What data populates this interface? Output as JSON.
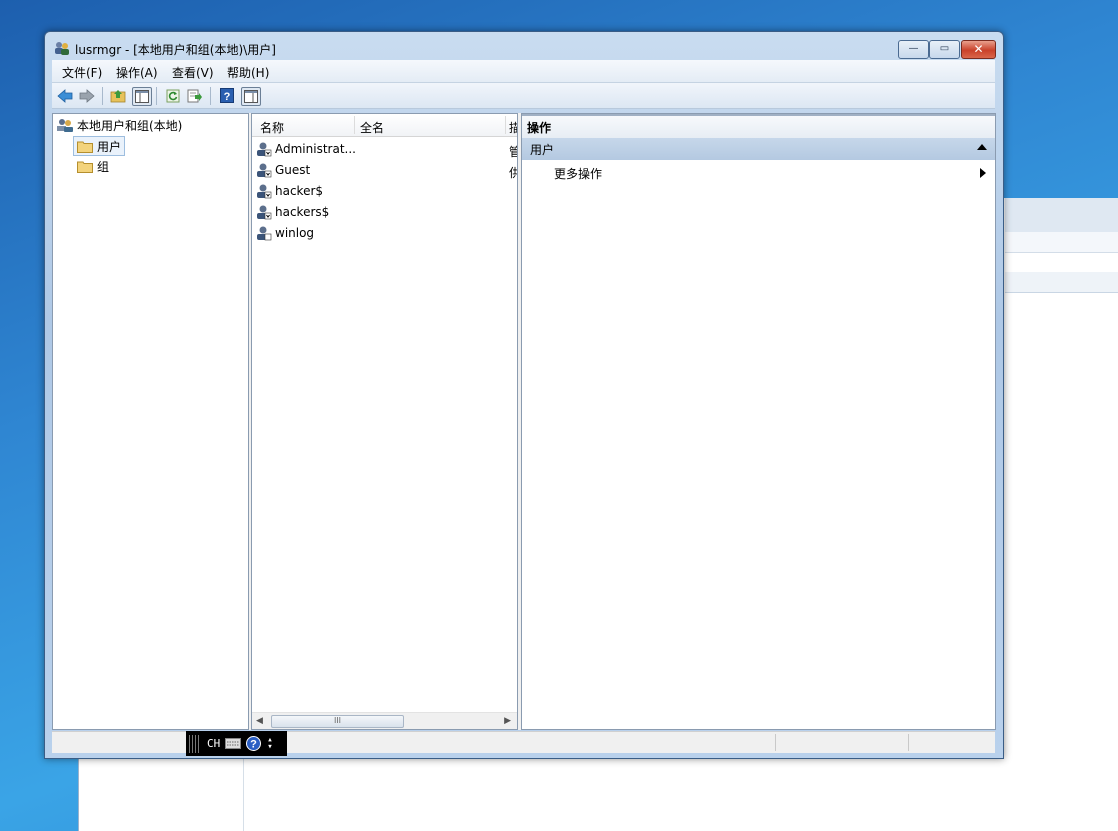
{
  "window": {
    "title": "lusrmgr - [本地用户和组(本地)\\用户]",
    "minimize_glyph": "—",
    "maximize_glyph": "▭",
    "close_glyph": "✕"
  },
  "menu": {
    "items": [
      "文件(F)",
      "操作(A)",
      "查看(V)",
      "帮助(H)"
    ]
  },
  "toolbar": {
    "icons": [
      "back-arrow-icon",
      "forward-arrow-icon",
      "up-folder-icon",
      "show-hide-tree-icon",
      "refresh-icon",
      "export-list-icon",
      "help-icon",
      "show-hide-action-pane-icon"
    ]
  },
  "tree": {
    "root": "本地用户和组(本地)",
    "items": [
      "用户",
      "组"
    ],
    "selected": "用户"
  },
  "list": {
    "columns": [
      "名称",
      "全名",
      "描"
    ],
    "rows": [
      {
        "name": "Administrat...",
        "fullname": "",
        "desc_clip": "管"
      },
      {
        "name": "Guest",
        "fullname": "",
        "desc_clip": "供"
      },
      {
        "name": "hacker$",
        "fullname": "",
        "desc_clip": ""
      },
      {
        "name": "hackers$",
        "fullname": "",
        "desc_clip": ""
      },
      {
        "name": "winlog",
        "fullname": "",
        "desc_clip": ""
      }
    ],
    "scroll_thumb_glyph": "III"
  },
  "actions": {
    "header": "操作",
    "section": "用户",
    "more_actions": "更多操作"
  },
  "ime": {
    "lang": "CH"
  },
  "colors": {
    "title_bar": "#b9d1ec",
    "selection": "#eaf2fb",
    "action_section": "#b4c9e1",
    "close_button": "#c9412a"
  }
}
